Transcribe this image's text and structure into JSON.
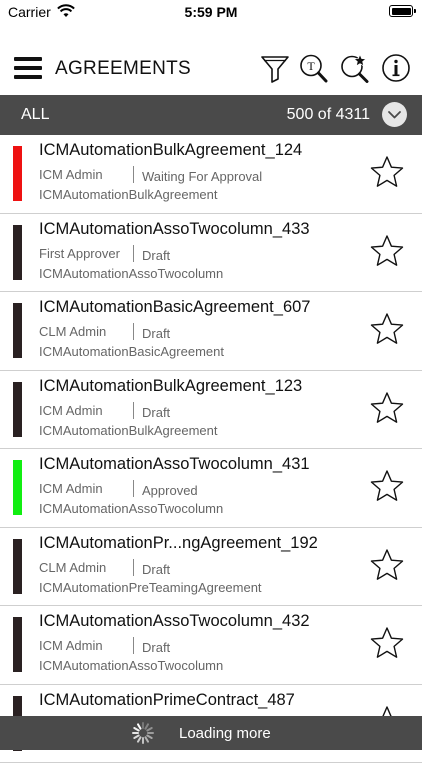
{
  "status_bar": {
    "carrier": "Carrier",
    "time": "5:59 PM"
  },
  "header": {
    "title": "AGREEMENTS"
  },
  "filter": {
    "label": "ALL",
    "count": "500 of 4311"
  },
  "agreements": [
    {
      "name": "ICMAutomationBulkAgreement_124",
      "owner": "ICM Admin",
      "status": "Waiting For Approval",
      "type": "ICMAutomationBulkAgreement",
      "color": "#ee1111"
    },
    {
      "name": "ICMAutomationAssoTwocolumn_433",
      "owner": "First Approver",
      "status": "Draft",
      "type": "ICMAutomationAssoTwocolumn",
      "color": "#2a2122"
    },
    {
      "name": "ICMAutomationBasicAgreement_607",
      "owner": "CLM Admin",
      "status": "Draft",
      "type": "ICMAutomationBasicAgreement",
      "color": "#2a2122"
    },
    {
      "name": "ICMAutomationBulkAgreement_123",
      "owner": "ICM Admin",
      "status": "Draft",
      "type": "ICMAutomationBulkAgreement",
      "color": "#2a2122"
    },
    {
      "name": "ICMAutomationAssoTwocolumn_431",
      "owner": "ICM Admin",
      "status": "Approved",
      "type": "ICMAutomationAssoTwocolumn",
      "color": "#11ee11"
    },
    {
      "name": "ICMAutomationPr...ngAgreement_192",
      "owner": "CLM Admin",
      "status": "Draft",
      "type": "ICMAutomationPreTeamingAgreement",
      "color": "#2a2122"
    },
    {
      "name": "ICMAutomationAssoTwocolumn_432",
      "owner": "ICM Admin",
      "status": "Draft",
      "type": "ICMAutomationAssoTwocolumn",
      "color": "#2a2122"
    },
    {
      "name": "ICMAutomationPrimeContract_487",
      "owner": "",
      "status": "",
      "type": "",
      "color": "#2a2122"
    }
  ],
  "loading": {
    "text": "Loading more"
  }
}
